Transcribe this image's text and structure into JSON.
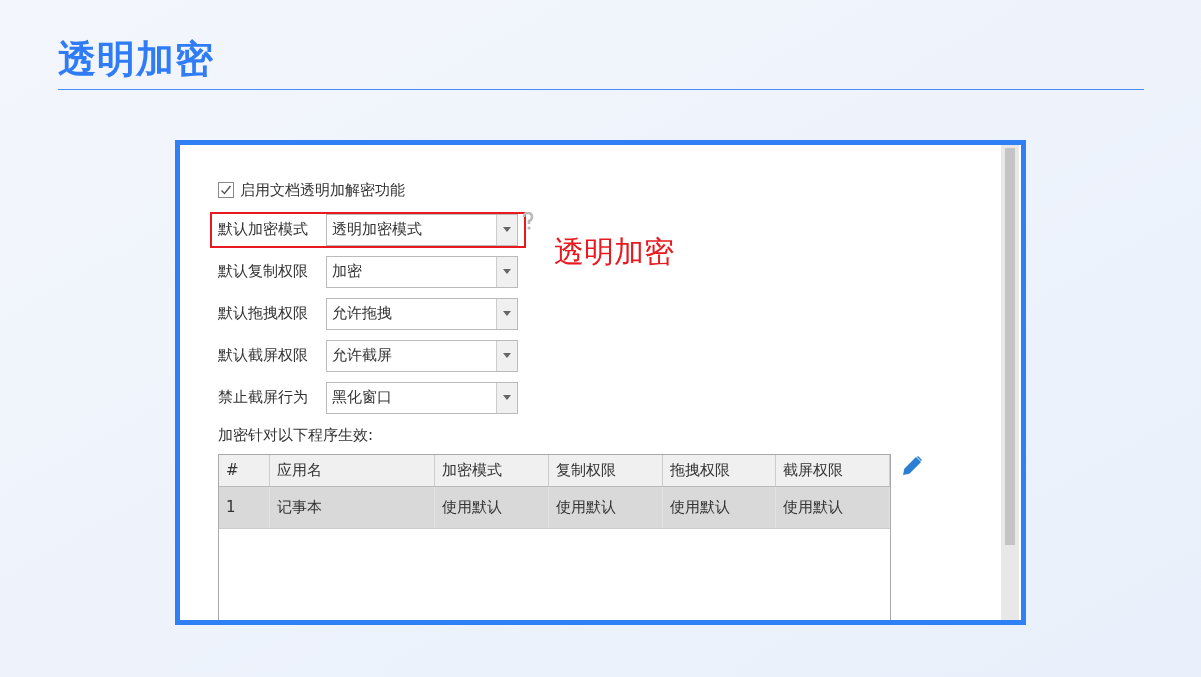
{
  "title": "透明加密",
  "panel": {
    "enable_option": {
      "label": "启用文档透明加解密功能",
      "checked": true
    },
    "settings": [
      {
        "label": "默认加密模式",
        "value": "透明加密模式",
        "highlighted": true,
        "help": true
      },
      {
        "label": "默认复制权限",
        "value": "加密",
        "highlighted": false,
        "help": false
      },
      {
        "label": "默认拖拽权限",
        "value": "允许拖拽",
        "highlighted": false,
        "help": false
      },
      {
        "label": "默认截屏权限",
        "value": "允许截屏",
        "highlighted": false,
        "help": false
      },
      {
        "label": "禁止截屏行为",
        "value": "黑化窗口",
        "highlighted": false,
        "help": false
      }
    ],
    "annotation": "透明加密",
    "table_caption": "加密针对以下程序生效:",
    "table": {
      "columns": [
        "#",
        "应用名",
        "加密模式",
        "复制权限",
        "拖拽权限",
        "截屏权限"
      ],
      "rows": [
        {
          "cells": [
            "1",
            "记事本",
            "使用默认",
            "使用默认",
            "使用默认",
            "使用默认"
          ],
          "selected": true
        }
      ]
    }
  }
}
